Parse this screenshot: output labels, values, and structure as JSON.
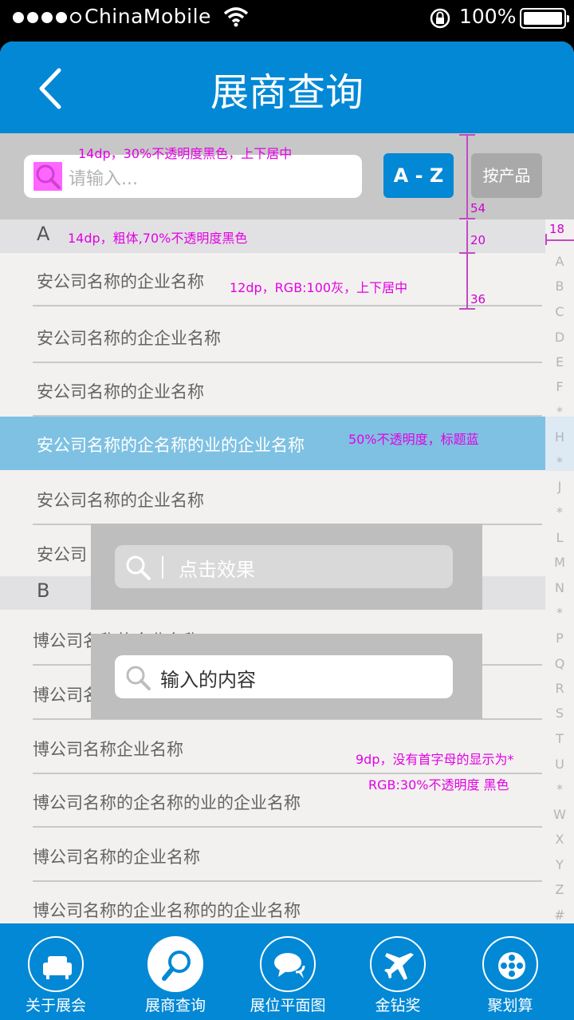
{
  "status_bar": {
    "carrier": "ChinaMobile",
    "battery": "100%"
  },
  "header": {
    "title": "展商查询"
  },
  "search": {
    "placeholder": "请输入...",
    "az_label": "A - Z",
    "product_label": "按产品"
  },
  "sections": [
    {
      "letter": "A",
      "items": [
        "安公司名称的企业名称",
        "安公司名称的企企业名称",
        "安公司名称的企业名称",
        "安公司名称的企名称的业的企业名称",
        "安公司名称的企业名称",
        "安公司"
      ]
    },
    {
      "letter": "B",
      "items": [
        "博公司名称的企业名称",
        "博公司名",
        "博公司名称企业名称",
        "博公司名称的企名称的业的企业名称",
        "博公司名称的企业名称",
        "博公司名称的企业名称的的企业名称"
      ]
    }
  ],
  "highlighted_item": "安公司名称的企名称的业的企业名称",
  "index_bar": [
    "A",
    "B",
    "C",
    "D",
    "E",
    "F",
    "*",
    "H",
    "*",
    "J",
    "*",
    "L",
    "M",
    "N",
    "*",
    "P",
    "Q",
    "R",
    "S",
    "T",
    "U",
    "*",
    "W",
    "X",
    "Y",
    "Z",
    "#"
  ],
  "annotations": {
    "search_font": "14dp，30%不透明度黑色，上下居中",
    "section_font": "14dp，粗体,70%不透明度黑色",
    "item_font": "12dp，RGB:100灰，上下居中",
    "highlight_note": "50%不透明度，标题蓝",
    "index_note_1": "9dp，没有首字母的显示为*",
    "index_note_2": "RGB:30%不透明度 黑色",
    "dim_54": "54",
    "dim_20": "20",
    "dim_36": "36",
    "dim_18": "18"
  },
  "popups": {
    "click_effect": "点击效果",
    "input_content": "输入的内容"
  },
  "tabs": [
    {
      "label": "关于展会",
      "icon": "sofa-icon"
    },
    {
      "label": "展商查询",
      "icon": "search-icon"
    },
    {
      "label": "展位平面图",
      "icon": "chat-icon"
    },
    {
      "label": "金钻奖",
      "icon": "plane-icon"
    },
    {
      "label": "聚划算",
      "icon": "film-reel-icon"
    }
  ],
  "colors": {
    "brand_blue": "#0288d5",
    "highlight": "#7ec1e3",
    "annotation": "#e400e4"
  }
}
